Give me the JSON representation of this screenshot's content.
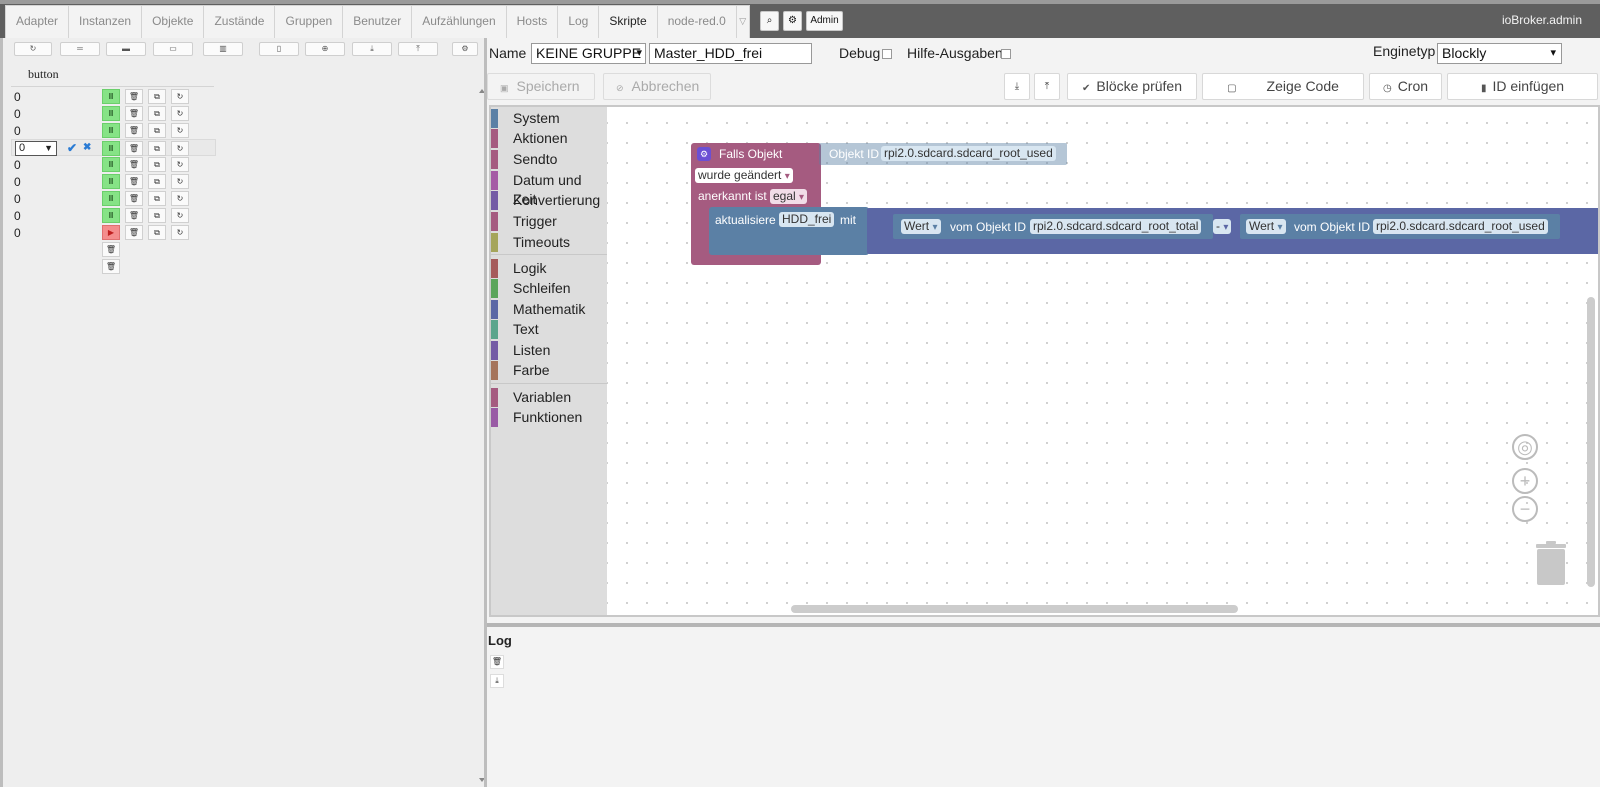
{
  "topbar": {
    "tabs": [
      "Adapter",
      "Instanzen",
      "Objekte",
      "Zustände",
      "Gruppen",
      "Benutzer",
      "Aufzählungen",
      "Hosts",
      "Log",
      "Skripte",
      "node-red.0"
    ],
    "active_tab": "Skripte",
    "more_glyph": "▽",
    "search_glyph": "⌕",
    "settings_glyph": "⚙",
    "admin_label": "Admin",
    "user": "ioBroker.admin"
  },
  "left": {
    "toolbar_glyphs": [
      "↻",
      "═",
      "▬",
      "▭",
      "▥",
      "▯",
      "⊕",
      "⤓",
      "⤒",
      "⚙"
    ],
    "column_header": "button",
    "rows": [
      {
        "value": "0",
        "state": "running"
      },
      {
        "value": "0",
        "state": "running"
      },
      {
        "value": "0",
        "state": "running"
      },
      {
        "value": "0",
        "state": "running",
        "editing": true
      },
      {
        "value": "0",
        "state": "running"
      },
      {
        "value": "0",
        "state": "running"
      },
      {
        "value": "0",
        "state": "running"
      },
      {
        "value": "0",
        "state": "running"
      },
      {
        "value": "0",
        "state": "stopped"
      }
    ],
    "pause_glyph": "II",
    "play_glyph": "▶",
    "delete_glyph": "🗑",
    "copy_glyph": "⧉",
    "refresh_glyph": "↻",
    "edit_select_value": "0",
    "edit_caret": "▼",
    "confirm_glyph": "✔",
    "cancel_glyph": "✖"
  },
  "editor": {
    "name_label": "Name",
    "group_value": "KEINE GRUPPE",
    "group_caret": "▾",
    "script_name": "Master_HDD_frei",
    "debug_label": "Debug",
    "hilfe_label": "Hilfe-Ausgaben",
    "engine_label": "Enginetyp",
    "engine_value": "Blockly",
    "engine_caret": "▾",
    "save_label": "Speichern",
    "cancel_label": "Abbrechen",
    "export_glyph": "⤓",
    "import_glyph": "⤒",
    "check_label": "Blöcke prüfen",
    "show_code_label": "Zeige Code",
    "cron_label": "Cron",
    "insert_id_label": "ID einfügen"
  },
  "toolbox": {
    "categories": [
      {
        "label": "System",
        "color": "#5b80a5"
      },
      {
        "label": "Aktionen",
        "color": "#a55b80"
      },
      {
        "label": "Sendto",
        "color": "#a55b80"
      },
      {
        "label": "Datum und Zeit",
        "color": "#a55ba5"
      },
      {
        "label": "Konvertierung",
        "color": "#745ba5"
      },
      {
        "label": "Trigger",
        "color": "#a55b80"
      },
      {
        "label": "Timeouts",
        "color": "#a5a55b"
      },
      {
        "label": "Logik",
        "color": "#a55b5b"
      },
      {
        "label": "Schleifen",
        "color": "#5ba55b"
      },
      {
        "label": "Mathematik",
        "color": "#5b67a5"
      },
      {
        "label": "Text",
        "color": "#5ba58c"
      },
      {
        "label": "Listen",
        "color": "#745ba5"
      },
      {
        "label": "Farbe",
        "color": "#a5745b"
      },
      {
        "label": "Variablen",
        "color": "#a55b80"
      },
      {
        "label": "Funktionen",
        "color": "#995ba5"
      }
    ]
  },
  "blocks": {
    "trigger_label": "Falls Objekt",
    "object_id_label": "Objekt ID",
    "trigger_object": "rpi2.0.sdcard.sdcard_root_used",
    "changed_value": "wurde geändert",
    "ack_label": "anerkannt ist",
    "ack_value": "egal",
    "dropdown_caret": "▾",
    "update_label": "aktualisiere",
    "update_var": "HDD_frei",
    "with_label": "mit",
    "left_value": "Wert",
    "from_object_label": "vom Objekt ID",
    "left_object": "rpi2.0.sdcard.sdcard_root_total",
    "operator": "-",
    "right_value": "Wert",
    "right_object": "rpi2.0.sdcard.sdcard_root_used"
  },
  "log": {
    "title": "Log",
    "delete_glyph": "🗑",
    "download_glyph": "⤓"
  }
}
